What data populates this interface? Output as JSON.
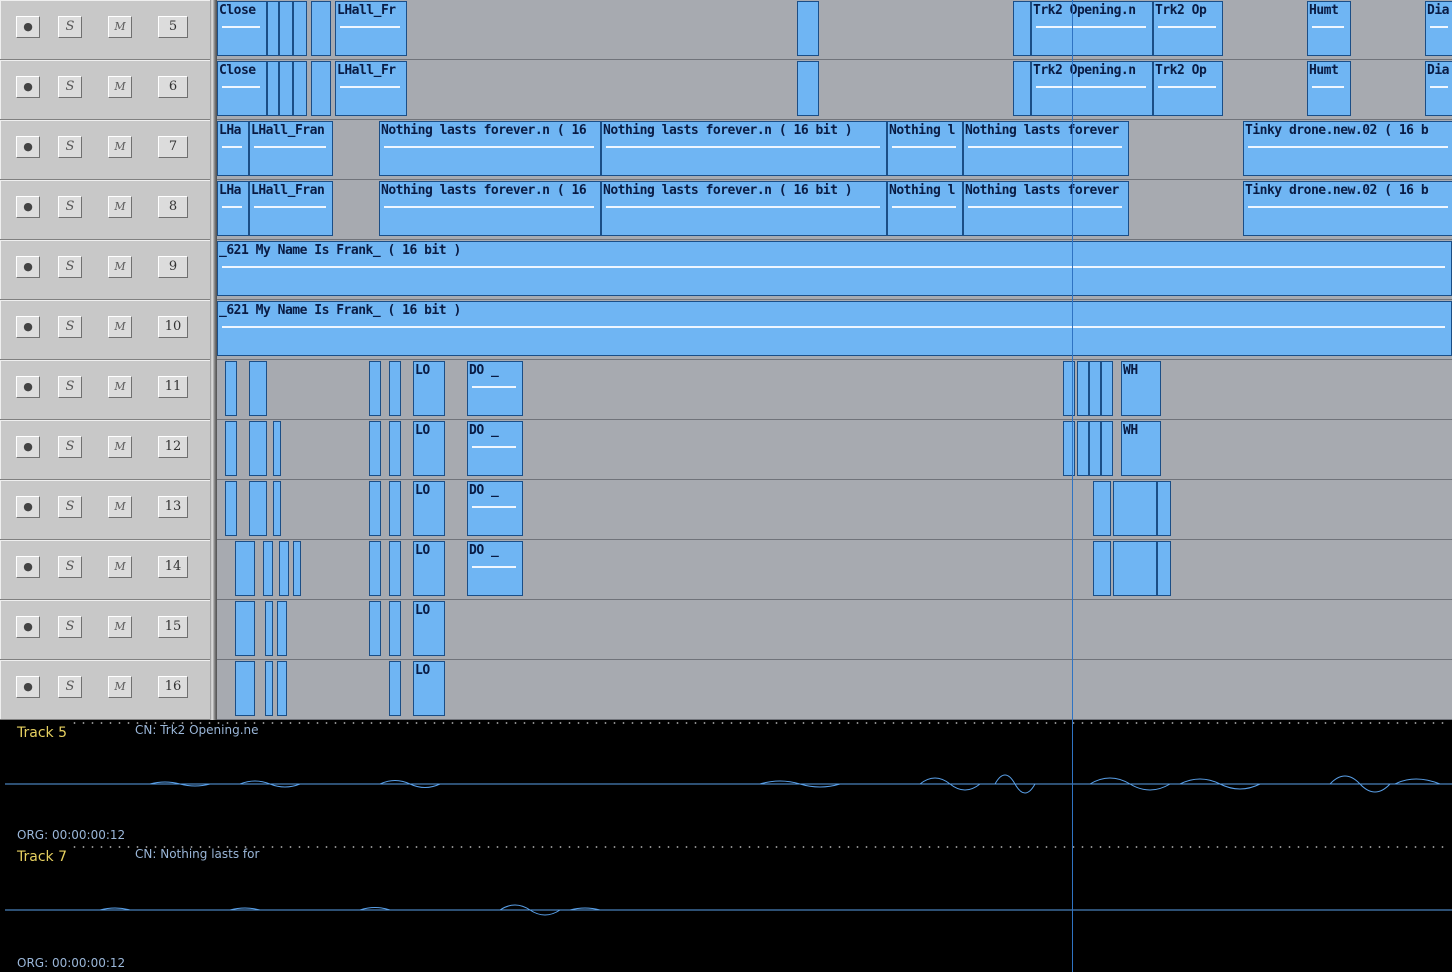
{
  "tracks": [
    {
      "rec": "●",
      "solo": "S",
      "mute": "M",
      "number": "5",
      "clips": [
        [
          "Close",
          0,
          50,
          "w"
        ],
        [
          "",
          50,
          12
        ],
        [
          "",
          62,
          14
        ],
        [
          "",
          76,
          14
        ],
        [
          "",
          94,
          20
        ],
        [
          "LHall_Fr",
          118,
          72,
          "w"
        ],
        [
          "",
          580,
          22
        ],
        [
          "",
          796,
          18
        ],
        [
          "Trk2 Opening.n",
          814,
          122,
          "w"
        ],
        [
          "Trk2 Op",
          936,
          70,
          "w"
        ],
        [
          "",
          1006,
          0
        ],
        [
          "Humt",
          1090,
          44,
          "w"
        ],
        [
          "Dia",
          1208,
          30,
          "w"
        ]
      ]
    },
    {
      "rec": "●",
      "solo": "S",
      "mute": "M",
      "number": "6",
      "clips": [
        [
          "Close",
          0,
          50,
          "w"
        ],
        [
          "",
          50,
          12
        ],
        [
          "",
          62,
          14
        ],
        [
          "",
          76,
          14
        ],
        [
          "",
          94,
          20
        ],
        [
          "LHall_Fr",
          118,
          72,
          "w"
        ],
        [
          "",
          580,
          22
        ],
        [
          "",
          796,
          18
        ],
        [
          "Trk2 Opening.n",
          814,
          122,
          "w"
        ],
        [
          "Trk2 Op",
          936,
          70,
          "w"
        ],
        [
          "Humt",
          1090,
          44,
          "w"
        ],
        [
          "Dia",
          1208,
          30,
          "w"
        ]
      ]
    },
    {
      "rec": "●",
      "solo": "S",
      "mute": "M",
      "number": "7",
      "clips": [
        [
          "LHa",
          0,
          32,
          "w"
        ],
        [
          "LHall_Fran",
          32,
          84,
          "w"
        ],
        [
          "Nothing lasts forever.n ( 16",
          162,
          222,
          "w"
        ],
        [
          "Nothing lasts forever.n ( 16 bit )",
          384,
          286,
          "w"
        ],
        [
          "Nothing l",
          670,
          76,
          "w"
        ],
        [
          "Nothing lasts forever",
          746,
          166,
          "w"
        ],
        [
          "Tinky drone.new.02 ( 16 b",
          1026,
          212,
          "w"
        ]
      ]
    },
    {
      "rec": "●",
      "solo": "S",
      "mute": "M",
      "number": "8",
      "clips": [
        [
          "LHa",
          0,
          32,
          "w"
        ],
        [
          "LHall_Fran",
          32,
          84,
          "w"
        ],
        [
          "Nothing lasts forever.n ( 16",
          162,
          222,
          "w"
        ],
        [
          "Nothing lasts forever.n ( 16 bit )",
          384,
          286,
          "w"
        ],
        [
          "Nothing l",
          670,
          76,
          "w"
        ],
        [
          "Nothing lasts forever",
          746,
          166,
          "w"
        ],
        [
          "Tinky drone.new.02 ( 16 b",
          1026,
          212,
          "w"
        ]
      ]
    },
    {
      "rec": "●",
      "solo": "S",
      "mute": "M",
      "number": "9",
      "clips": [
        [
          "_621 My Name Is Frank_  ( 16 bit )",
          0,
          1235,
          "w"
        ]
      ]
    },
    {
      "rec": "●",
      "solo": "S",
      "mute": "M",
      "number": "10",
      "clips": [
        [
          "_621 My Name Is Frank_  ( 16 bit )",
          0,
          1235,
          "w"
        ]
      ]
    },
    {
      "rec": "●",
      "solo": "S",
      "mute": "M",
      "number": "11",
      "clips": [
        [
          "",
          8,
          12
        ],
        [
          "",
          32,
          18
        ],
        [
          "",
          152,
          12
        ],
        [
          "",
          172,
          12
        ],
        [
          "LO",
          196,
          32
        ],
        [
          "DO _",
          250,
          56,
          "w"
        ],
        [
          "",
          846,
          12
        ],
        [
          "",
          860,
          12
        ],
        [
          "",
          872,
          12
        ],
        [
          "",
          884,
          12
        ],
        [
          "WH",
          904,
          40
        ]
      ]
    },
    {
      "rec": "●",
      "solo": "S",
      "mute": "M",
      "number": "12",
      "clips": [
        [
          "",
          8,
          12
        ],
        [
          "",
          32,
          18
        ],
        [
          "",
          56,
          8
        ],
        [
          "",
          152,
          12
        ],
        [
          "",
          172,
          12
        ],
        [
          "LO",
          196,
          32
        ],
        [
          "DO _",
          250,
          56,
          "w"
        ],
        [
          "",
          846,
          12
        ],
        [
          "",
          860,
          12
        ],
        [
          "",
          872,
          12
        ],
        [
          "",
          884,
          12
        ],
        [
          "WH",
          904,
          40
        ]
      ]
    },
    {
      "rec": "●",
      "solo": "S",
      "mute": "M",
      "number": "13",
      "clips": [
        [
          "",
          8,
          12
        ],
        [
          "",
          32,
          18
        ],
        [
          "",
          56,
          8
        ],
        [
          "",
          152,
          12
        ],
        [
          "",
          172,
          12
        ],
        [
          "LO",
          196,
          32
        ],
        [
          "DO _",
          250,
          56,
          "w"
        ],
        [
          "",
          876,
          18
        ],
        [
          "",
          896,
          44
        ],
        [
          "",
          940,
          14
        ]
      ]
    },
    {
      "rec": "●",
      "solo": "S",
      "mute": "M",
      "number": "14",
      "clips": [
        [
          "",
          18,
          20
        ],
        [
          "",
          46,
          10
        ],
        [
          "",
          62,
          10
        ],
        [
          "",
          76,
          8
        ],
        [
          "",
          152,
          12
        ],
        [
          "",
          172,
          12
        ],
        [
          "LO",
          196,
          32
        ],
        [
          "DO _",
          250,
          56,
          "w"
        ],
        [
          "",
          876,
          18
        ],
        [
          "",
          896,
          44
        ],
        [
          "",
          940,
          14
        ]
      ]
    },
    {
      "rec": "●",
      "solo": "S",
      "mute": "M",
      "number": "15",
      "clips": [
        [
          "",
          18,
          20
        ],
        [
          "",
          48,
          8
        ],
        [
          "",
          60,
          10
        ],
        [
          "",
          152,
          12
        ],
        [
          "",
          172,
          12
        ],
        [
          "LO",
          196,
          32
        ]
      ]
    },
    {
      "rec": "●",
      "solo": "S",
      "mute": "M",
      "number": "16",
      "clips": [
        [
          "",
          18,
          20
        ],
        [
          "",
          48,
          8
        ],
        [
          "",
          60,
          10
        ],
        [
          "",
          172,
          12
        ],
        [
          "LO",
          196,
          32
        ]
      ]
    }
  ],
  "waveform_panels": [
    {
      "track": "Track 5",
      "clip_name": "CN: Trk2 Opening.ne",
      "origin": "ORG: 00:00:00:12"
    },
    {
      "track": "Track 7",
      "clip_name": "CN: Nothing lasts for",
      "origin": "ORG: 00:00:00:12"
    }
  ],
  "colors": {
    "clip": "#6fb5f3",
    "lane": "#a7aab0",
    "cursor": "#2f73c2",
    "waveform": "#5aa0e8"
  }
}
